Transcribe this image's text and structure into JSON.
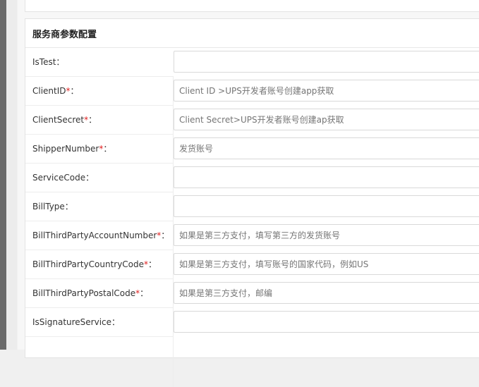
{
  "section": {
    "title": "服务商参数配置"
  },
  "fields": [
    {
      "key": "IsTest",
      "label": "IsTest",
      "required": false,
      "value": "",
      "placeholder": ""
    },
    {
      "key": "ClientID",
      "label": "ClientID",
      "required": true,
      "value": "",
      "placeholder": "Client ID >UPS开发者账号创建app获取"
    },
    {
      "key": "ClientSecret",
      "label": "ClientSecret",
      "required": true,
      "value": "",
      "placeholder": "Client Secret>UPS开发者账号创建ap获取"
    },
    {
      "key": "ShipperNumber",
      "label": "ShipperNumber",
      "required": true,
      "value": "",
      "placeholder": "发货账号"
    },
    {
      "key": "ServiceCode",
      "label": "ServiceCode",
      "required": false,
      "value": "",
      "placeholder": ""
    },
    {
      "key": "BillType",
      "label": "BillType",
      "required": false,
      "value": "",
      "placeholder": ""
    },
    {
      "key": "BillThirdPartyAccountNumber",
      "label": "BillThirdPartyAccountNumber",
      "required": true,
      "value": "",
      "placeholder": "如果是第三方支付，填写第三方的发货账号"
    },
    {
      "key": "BillThirdPartyCountryCode",
      "label": "BillThirdPartyCountryCode",
      "required": true,
      "value": "",
      "placeholder": "如果是第三方支付，填写账号的国家代码，例如US"
    },
    {
      "key": "BillThirdPartyPostalCode",
      "label": "BillThirdPartyPostalCode",
      "required": true,
      "value": "",
      "placeholder": "如果是第三方支付，邮编"
    },
    {
      "key": "IsSignatureService",
      "label": "IsSignatureService",
      "required": false,
      "value": "",
      "placeholder": ""
    }
  ],
  "ui": {
    "required_mark": "*",
    "label_suffix": "："
  }
}
